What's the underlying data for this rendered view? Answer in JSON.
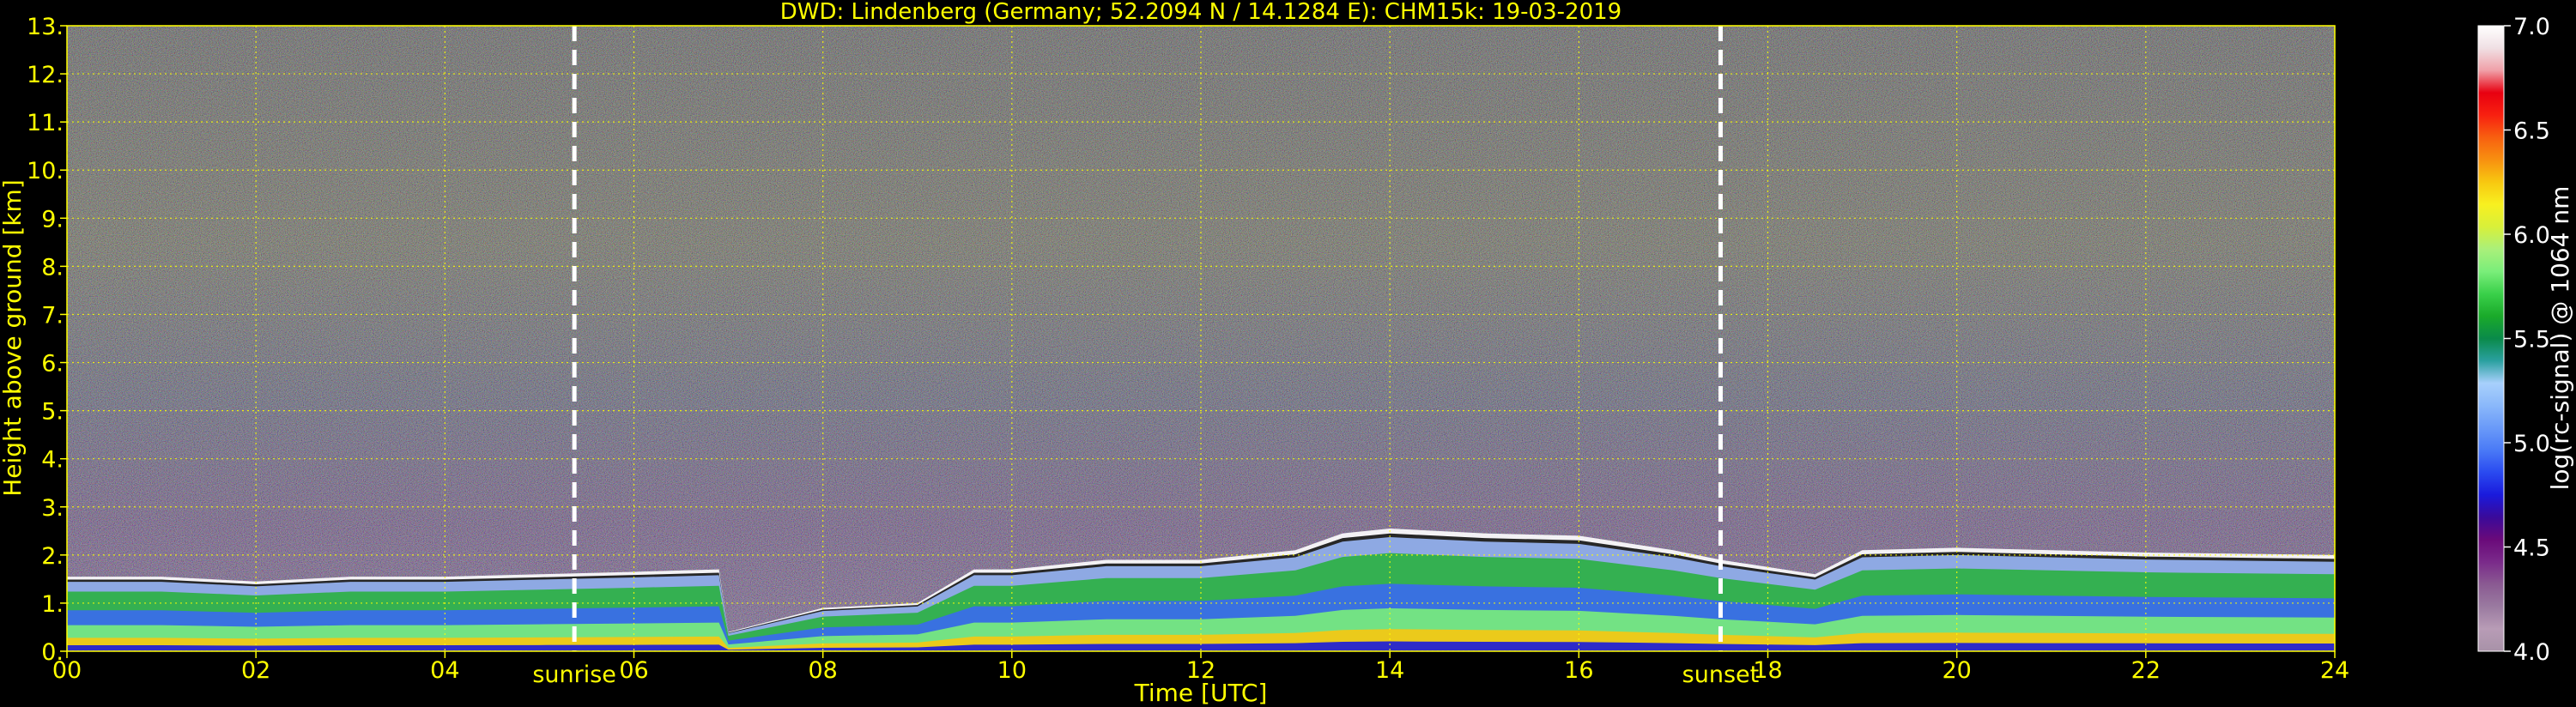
{
  "chart_data": {
    "type": "heatmap",
    "title": "DWD: Lindenberg (Germany; 52.2094 N / 14.1284 E):     CHM15k: 19-03-2019",
    "xlabel": "Time [UTC]",
    "ylabel": "Height above ground [km]",
    "x_ticks": [
      "00",
      "02",
      "04",
      "06",
      "08",
      "10",
      "12",
      "14",
      "16",
      "18",
      "20",
      "22",
      "24"
    ],
    "y_ticks": [
      "0.",
      "1.",
      "2.",
      "3.",
      "4.",
      "5.",
      "6.",
      "7.",
      "8.",
      "9.",
      "10.",
      "11.",
      "12.",
      "13."
    ],
    "xlim": [
      0,
      24
    ],
    "ylim": [
      0,
      13
    ],
    "grid": true,
    "colorbar": {
      "label": "log(rc-signal) @ 1064 nm",
      "ticks": [
        "4.0",
        "4.5",
        "5.0",
        "5.5",
        "6.0",
        "6.5",
        "7.0"
      ],
      "range": [
        4.0,
        7.0
      ],
      "colors": [
        "#a892a8",
        "#b89cb6",
        "#9a7aa0",
        "#8a5a92",
        "#7a2a8a",
        "#6a0a7a",
        "#3a0a9a",
        "#1a1adc",
        "#2a4af0",
        "#4a7af6",
        "#6a9af8",
        "#8ab8fa",
        "#a8d0fc",
        "#2aa0a0",
        "#0a8a4a",
        "#1aaa2a",
        "#3ad04a",
        "#7aee7a",
        "#aaf07a",
        "#d8f03a",
        "#f8f020",
        "#f8c810",
        "#f89010",
        "#f86010",
        "#f82010",
        "#e80010",
        "#f0a0a8",
        "#f0e0e4",
        "#ffffff"
      ]
    },
    "annotations": [
      {
        "text": "sunrise",
        "x": 5.37
      },
      {
        "text": "sunset",
        "x": 17.5
      }
    ],
    "aerosol_layer_top_km": [
      [
        0.0,
        1.55
      ],
      [
        1.0,
        1.55
      ],
      [
        2.0,
        1.45
      ],
      [
        3.0,
        1.55
      ],
      [
        4.0,
        1.55
      ],
      [
        5.0,
        1.6
      ],
      [
        6.0,
        1.65
      ],
      [
        6.9,
        1.7
      ],
      [
        7.0,
        0.4
      ],
      [
        8.0,
        0.9
      ],
      [
        9.0,
        1.0
      ],
      [
        9.6,
        1.7
      ],
      [
        10.0,
        1.7
      ],
      [
        11.0,
        1.9
      ],
      [
        12.0,
        1.9
      ],
      [
        13.0,
        2.1
      ],
      [
        13.5,
        2.45
      ],
      [
        14.0,
        2.55
      ],
      [
        15.0,
        2.45
      ],
      [
        16.0,
        2.4
      ],
      [
        17.0,
        2.1
      ],
      [
        17.5,
        1.9
      ],
      [
        18.5,
        1.6
      ],
      [
        19.0,
        2.1
      ],
      [
        20.0,
        2.15
      ],
      [
        21.0,
        2.1
      ],
      [
        22.0,
        2.05
      ],
      [
        24.0,
        2.0
      ]
    ]
  }
}
